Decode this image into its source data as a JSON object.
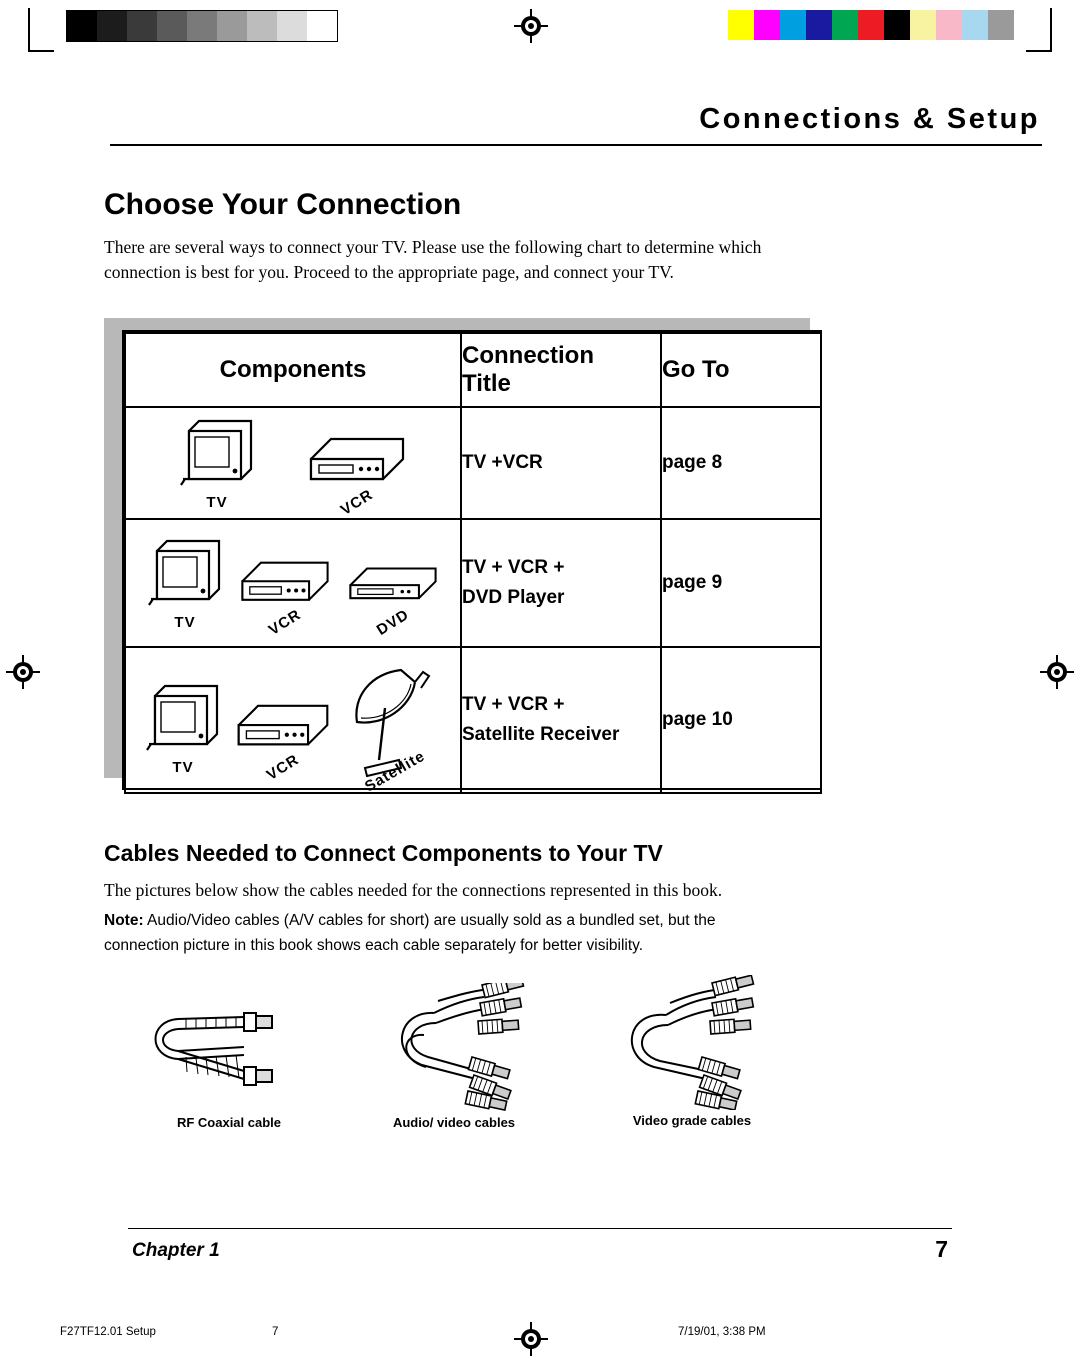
{
  "header": {
    "title": "Connections & Setup"
  },
  "headings": {
    "h1": "Choose Your Connection",
    "h2": "Cables Needed to Connect Components to Your TV"
  },
  "paragraphs": {
    "intro": "There are several ways to connect your TV. Please use the following chart to determine which connection is best for you. Proceed to the appropriate page, and connect your TV.",
    "pictures": "The pictures below show the cables needed for the connections represented in this book.",
    "note_label": "Note:",
    "note_text": " Audio/Video cables (A/V cables for short) are usually sold as a bundled set, but the connection picture in this book shows each cable separately for better visibility."
  },
  "table": {
    "headers": {
      "components": "Components",
      "connection_title_line1": "Connection",
      "connection_title_line2": "Title",
      "go_to": "Go To"
    },
    "rows": [
      {
        "devices": [
          "TV",
          "VCR"
        ],
        "title_lines": [
          "TV +VCR"
        ],
        "goto": "page 8"
      },
      {
        "devices": [
          "TV",
          "VCR",
          "DVD"
        ],
        "title_lines": [
          "TV + VCR +",
          "DVD Player"
        ],
        "goto": "page 9"
      },
      {
        "devices": [
          "TV",
          "VCR",
          "Satellite"
        ],
        "title_lines": [
          "TV + VCR +",
          "Satellite Receiver"
        ],
        "goto": "page 10"
      }
    ]
  },
  "cables": [
    {
      "caption": "RF Coaxial cable"
    },
    {
      "caption": "Audio/ video cables"
    },
    {
      "caption": "Video grade cables"
    }
  ],
  "footer": {
    "chapter": "Chapter 1",
    "page_number": "7",
    "doc_id": "F27TF12.01 Setup",
    "doc_page": "7",
    "doc_timestamp": "7/19/01, 3:38 PM"
  },
  "colors": {
    "text": "#000000",
    "shadow": "#b8b8b8",
    "colorbar": [
      "#ffff00",
      "#ff00ff",
      "#00a0e0",
      "#1a1aa0",
      "#00a651",
      "#ed1c24",
      "#000000",
      "#f7f3a0",
      "#f9b8c8",
      "#a8d8f0",
      "#9a9a9a"
    ],
    "graybar": [
      "#000000",
      "#1c1c1c",
      "#3a3a3a",
      "#5a5a5a",
      "#7a7a7a",
      "#9a9a9a",
      "#bcbcbc",
      "#dcdcdc",
      "#ffffff"
    ]
  }
}
